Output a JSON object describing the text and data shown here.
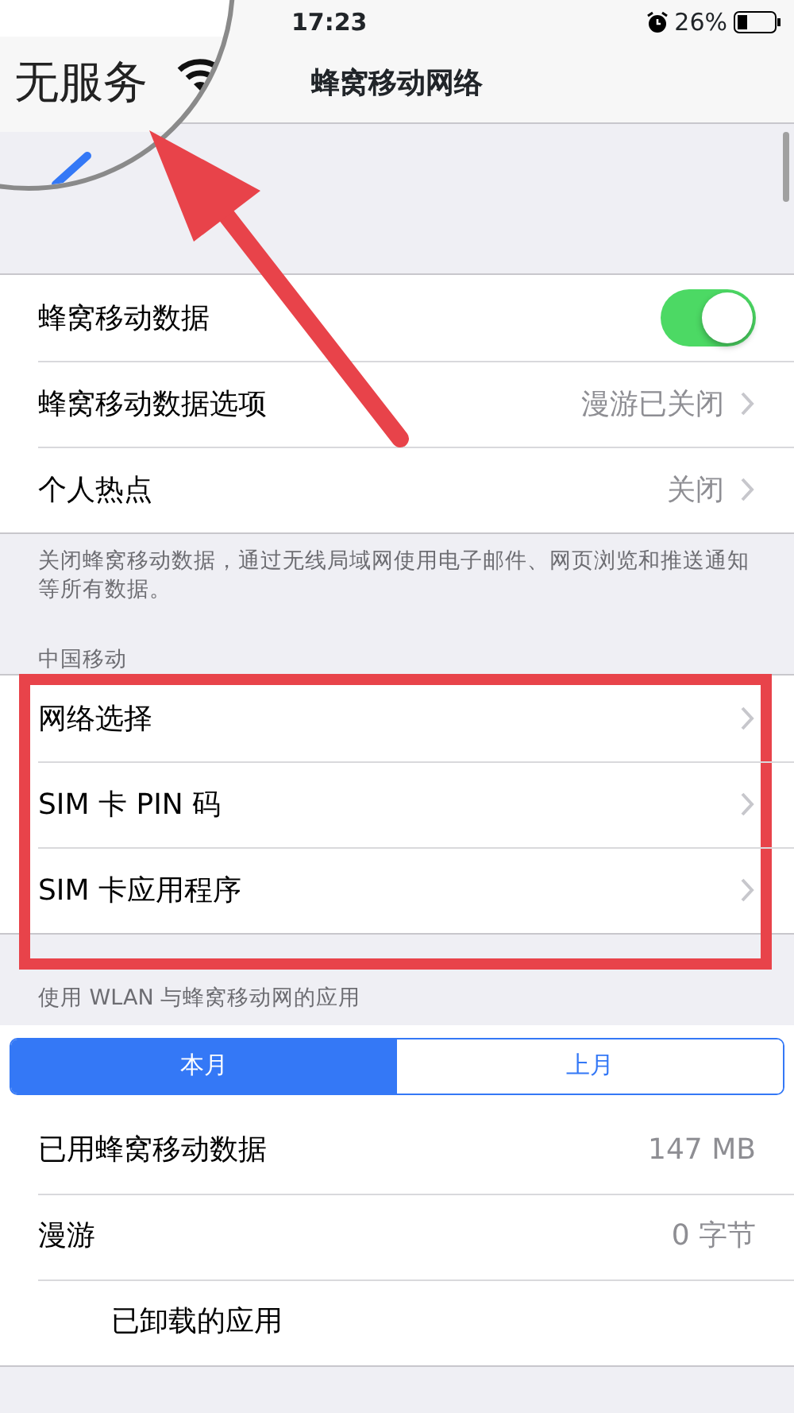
{
  "status_bar": {
    "time": "17:23",
    "battery": "26%"
  },
  "nav": {
    "title": "蜂窝移动网络"
  },
  "magnifier": {
    "carrier": "无服务"
  },
  "groups": [
    {
      "rows": [
        {
          "kind": "toggle",
          "label": "蜂窝移动数据",
          "on": true
        },
        {
          "kind": "detail",
          "label": "蜂窝移动数据选项",
          "value": "漫游已关闭"
        },
        {
          "kind": "detail",
          "label": "个人热点",
          "value": "关闭"
        }
      ],
      "footer": "关闭蜂窝移动数据，通过无线局域网使用电子邮件、网页浏览和推送通知等所有数据。"
    },
    {
      "header": "中国移动",
      "highlighted": true,
      "rows": [
        {
          "kind": "link",
          "label": "网络选择"
        },
        {
          "kind": "link",
          "label": "SIM 卡 PIN 码"
        },
        {
          "kind": "link",
          "label": "SIM 卡应用程序"
        }
      ]
    },
    {
      "header": "使用 WLAN 与蜂窝移动网的应用",
      "segments": [
        {
          "label": "本月",
          "selected": true
        },
        {
          "label": "上月",
          "selected": false
        }
      ],
      "rows": [
        {
          "kind": "stat",
          "label": "已用蜂窝移动数据",
          "value": "147 MB"
        },
        {
          "kind": "stat",
          "label": "漫游",
          "value": "0 字节"
        },
        {
          "kind": "app",
          "label": "已卸载的应用"
        }
      ]
    }
  ]
}
